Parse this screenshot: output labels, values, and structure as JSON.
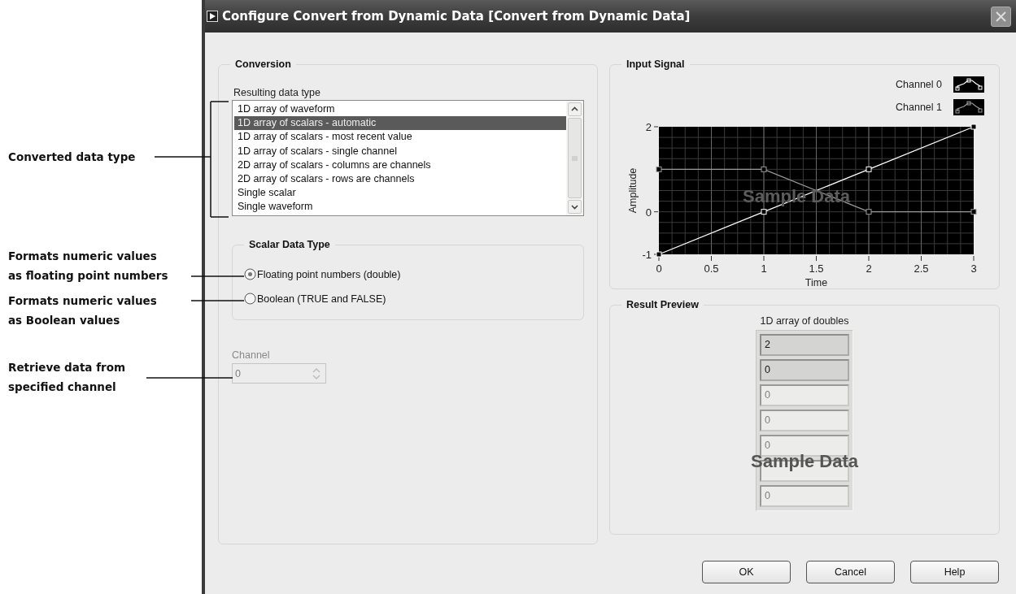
{
  "annotations": [
    {
      "text": "Converted data type"
    },
    {
      "text": "Formats numeric values\nas floating point numbers"
    },
    {
      "text": "Formats numeric values\nas Boolean values"
    },
    {
      "text": "Retrieve data from\nspecified channel"
    }
  ],
  "window": {
    "title": "Configure Convert from Dynamic Data [Convert from Dynamic Data]"
  },
  "conversion": {
    "title": "Conversion",
    "list_label": "Resulting data type",
    "items": [
      {
        "label": "1D array of waveform",
        "selected": false
      },
      {
        "label": "1D array of scalars - automatic",
        "selected": true
      },
      {
        "label": "1D array of scalars - most recent value",
        "selected": false
      },
      {
        "label": "1D array of scalars - single channel",
        "selected": false
      },
      {
        "label": "2D array of scalars - columns are channels",
        "selected": false
      },
      {
        "label": "2D array of scalars - rows are channels",
        "selected": false
      },
      {
        "label": "Single scalar",
        "selected": false
      },
      {
        "label": "Single waveform",
        "selected": false
      }
    ],
    "scalar_type": {
      "title": "Scalar Data Type",
      "options": [
        {
          "label": "Floating point numbers (double)",
          "selected": true
        },
        {
          "label": "Boolean (TRUE and FALSE)",
          "selected": false
        }
      ]
    },
    "channel": {
      "label": "Channel",
      "value": "0",
      "disabled": true
    }
  },
  "input_signal": {
    "title": "Input Signal",
    "overlay_label": "Sample Data",
    "chart_data": {
      "type": "line",
      "xlabel": "Time",
      "ylabel": "Amplitude",
      "x": [
        0,
        1,
        2,
        3
      ],
      "series": [
        {
          "name": "Channel 0",
          "color": "#ffffff",
          "marker": "square",
          "values": [
            -1,
            0,
            1,
            2
          ]
        },
        {
          "name": "Channel 1",
          "color": "#9a9a9a",
          "marker": "square",
          "values": [
            1,
            1,
            0,
            0
          ]
        }
      ],
      "xlim": [
        0,
        3
      ],
      "ylim": [
        -1,
        2
      ],
      "grid": true,
      "xticks": [
        0,
        0.5,
        1,
        1.5,
        2,
        2.5,
        3
      ],
      "yticks": [
        -1,
        0,
        2
      ]
    }
  },
  "result_preview": {
    "title": "Result Preview",
    "array_label": "1D array of doubles",
    "overlay_label": "Sample Data",
    "cells": [
      {
        "value": "2",
        "active": true
      },
      {
        "value": "0",
        "active": true
      },
      {
        "value": "0",
        "active": false
      },
      {
        "value": "0",
        "active": false
      },
      {
        "value": "0",
        "active": false
      },
      {
        "active": false
      },
      {
        "value": "0",
        "active": false
      }
    ]
  },
  "buttons": [
    {
      "label": "OK"
    },
    {
      "label": "Cancel"
    },
    {
      "label": "Help"
    }
  ]
}
